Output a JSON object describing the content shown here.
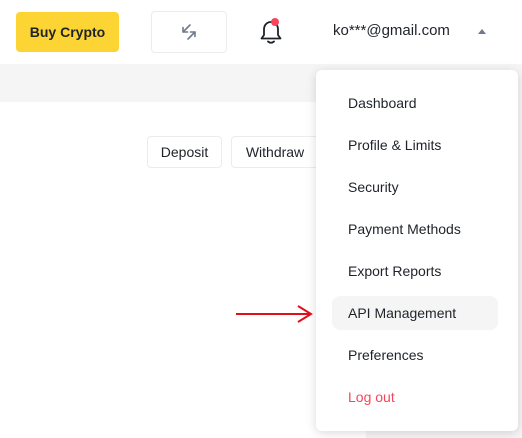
{
  "header": {
    "buy_label": "Buy Crypto",
    "account_email": "ko***@gmail.com",
    "icons": {
      "swap": "swap-arrows-icon",
      "bell": "bell-icon",
      "caret": "caret-up-icon"
    },
    "colors": {
      "accent": "#fcd535",
      "notification": "#f6465d"
    }
  },
  "actions": {
    "deposit_label": "Deposit",
    "withdraw_label": "Withdraw"
  },
  "menu": {
    "items": [
      {
        "label": "Dashboard"
      },
      {
        "label": "Profile & Limits"
      },
      {
        "label": "Security"
      },
      {
        "label": "Payment Methods"
      },
      {
        "label": "Export Reports"
      },
      {
        "label": "API Management",
        "active": true
      },
      {
        "label": "Preferences"
      },
      {
        "label": "Log out",
        "color": "#f6465d"
      }
    ]
  },
  "annotation": {
    "arrow_color": "#e0101a"
  }
}
